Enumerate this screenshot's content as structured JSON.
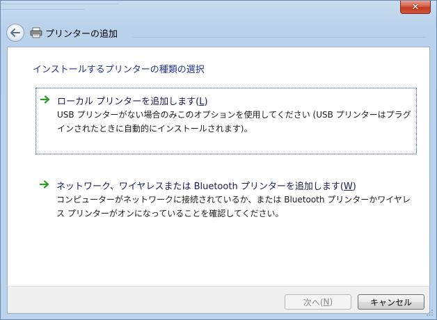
{
  "window": {
    "title": "プリンターの追加",
    "close_label": "✕"
  },
  "content": {
    "heading": "インストールするプリンターの種類の選択",
    "options": [
      {
        "title_pre": "ローカル プリンターを追加します(",
        "accel": "L",
        "title_post": ")",
        "description": "USB プリンターがない場合のみこのオプションを使用してください (USB プリンターはプラグインされたときに自動的にインストールされます)。"
      },
      {
        "title_pre": "ネットワーク、ワイヤレスまたは Bluetooth プリンターを追加します(",
        "accel": "W",
        "title_post": ")",
        "description": "コンピューターがネットワークに接続されているか、または Bluetooth プリンターかワイヤレス プリンターがオンになっていることを確認してください。"
      }
    ]
  },
  "footer": {
    "next": {
      "pre": "次へ(",
      "accel": "N",
      "post": ")"
    },
    "cancel_label": "キャンセル"
  },
  "colors": {
    "heading": "#1e3287",
    "option_title": "#151c55",
    "arrow": "#2f9e2f"
  },
  "icons": {
    "back": "back-arrow-icon",
    "printer": "printer-icon",
    "option_arrow": "green-arrow-icon"
  }
}
